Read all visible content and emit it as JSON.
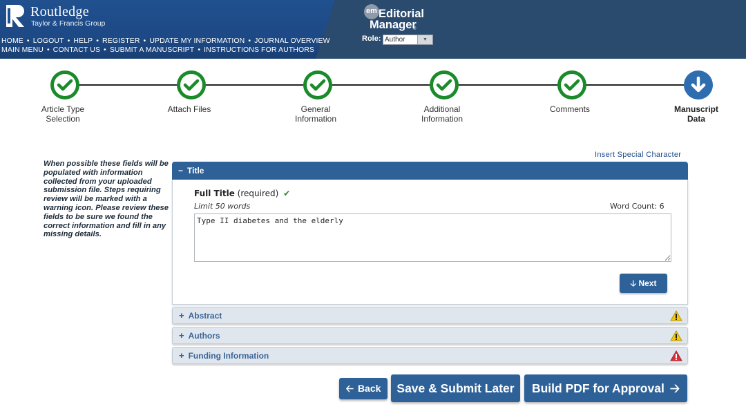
{
  "brand": {
    "name": "Routledge",
    "sub": "Taylor & Francis Group"
  },
  "nav": {
    "row1": [
      "HOME",
      "LOGOUT",
      "HELP",
      "REGISTER",
      "UPDATE MY INFORMATION",
      "JOURNAL OVERVIEW"
    ],
    "row2": [
      "MAIN MENU",
      "CONTACT US",
      "SUBMIT A MANUSCRIPT",
      "INSTRUCTIONS FOR AUTHORS"
    ]
  },
  "em": {
    "badge": "em",
    "title1": "Editorial",
    "title2": "Manager",
    "tm": "®",
    "role_label": "Role:",
    "role_value": "Author"
  },
  "steps": [
    {
      "label_line1": "Article Type",
      "label_line2": "Selection",
      "status": "complete"
    },
    {
      "label_line1": "Attach Files",
      "label_line2": "",
      "status": "complete"
    },
    {
      "label_line1": "General",
      "label_line2": "Information",
      "status": "complete"
    },
    {
      "label_line1": "Additional",
      "label_line2": "Information",
      "status": "complete"
    },
    {
      "label_line1": "Comments",
      "label_line2": "",
      "status": "complete"
    },
    {
      "label_line1": "Manuscript",
      "label_line2": "Data",
      "status": "current"
    }
  ],
  "help_text": "When possible these fields will be populated with information collected from your uploaded submission file. Steps requiring review will be marked with a warning icon. Please review these fields to be sure we found the correct information and fill in any missing details.",
  "insert_special": "Insert Special Character",
  "title_section": {
    "header": "Title",
    "toggle": "−",
    "field_label": "Full Title",
    "required": "(required)",
    "check": "✔",
    "limit": "Limit 50 words",
    "word_count": "Word Count: 6",
    "value": "Type II diabetes and the elderly",
    "next_label": "Next",
    "next_arrow": "🡣"
  },
  "sections": [
    {
      "label": "Abstract",
      "toggle": "+",
      "warning": "caution",
      "color": "#e8c000"
    },
    {
      "label": "Authors",
      "toggle": "+",
      "warning": "caution",
      "color": "#e8c000"
    },
    {
      "label": "Funding Information",
      "toggle": "+",
      "warning": "error",
      "color": "#d9303a"
    }
  ],
  "buttons": {
    "back": "Back",
    "save": "Save & Submit Later",
    "pdf": "Build PDF for Approval"
  },
  "colors": {
    "header_bg": "#2a4a6e",
    "accent": "#2f6199",
    "step_complete": "#1b8a2a",
    "step_current": "#2e6eb0"
  }
}
